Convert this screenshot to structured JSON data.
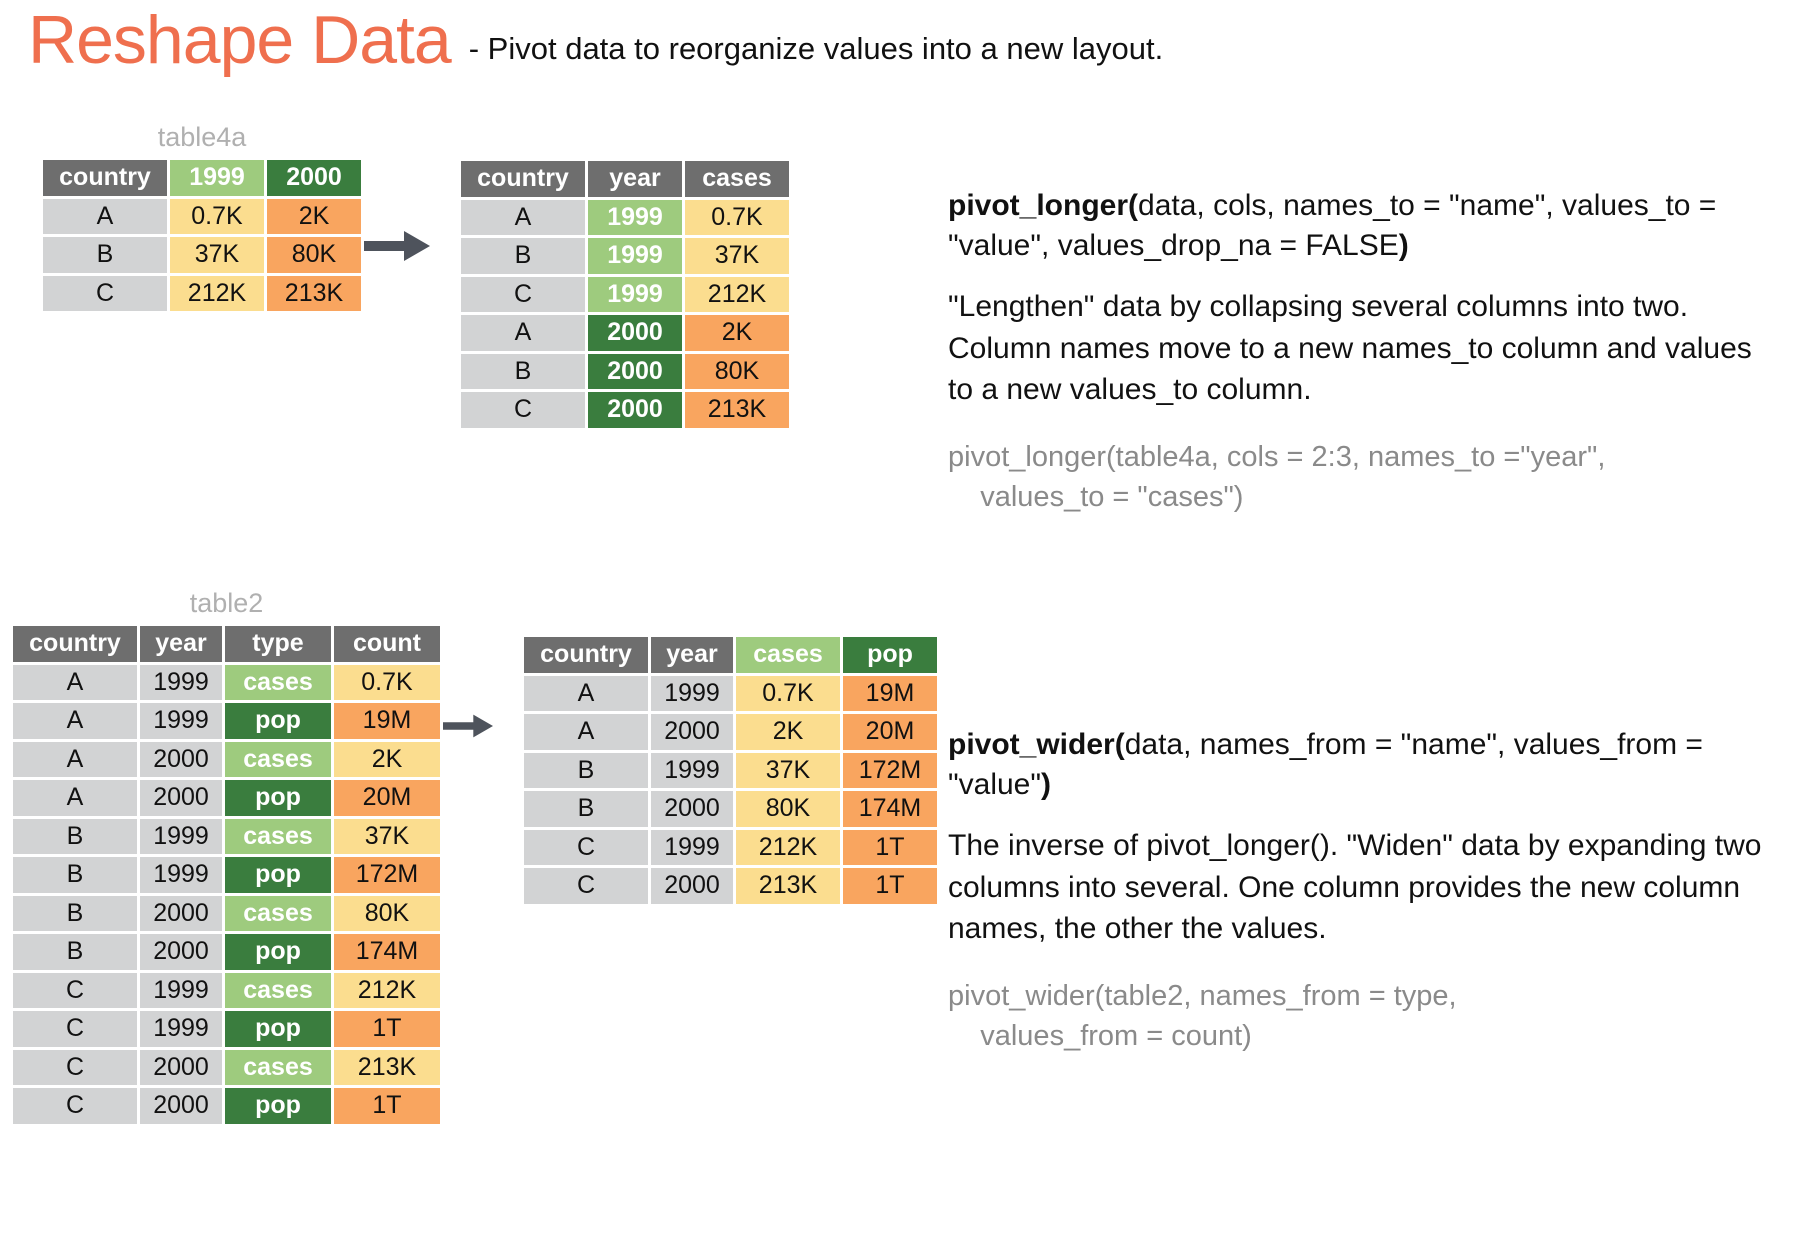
{
  "header": {
    "title": "Reshape Data",
    "subtitle": "- Pivot data to reorganize values into a new layout.",
    "title_color": "#ef6f4e"
  },
  "palette": {
    "header_grey": "#6e6e6e",
    "cell_grey": "#d2d3d4",
    "green_light": "#9ecb7e",
    "green_dark": "#3a7d3e",
    "yellow": "#fbdd8f",
    "orange": "#f9a55f",
    "label_grey": "#b0b0b0",
    "code_grey": "#8a8a8a",
    "arrow": "#4e535c"
  },
  "icons": {
    "arrow_right": "arrow-right-icon"
  },
  "pivot_longer": {
    "source_table": {
      "label": "table4a",
      "headers": [
        "country",
        "1999",
        "2000"
      ],
      "rows": [
        [
          "A",
          "0.7K",
          "2K"
        ],
        [
          "B",
          "37K",
          "80K"
        ],
        [
          "C",
          "212K",
          "213K"
        ]
      ]
    },
    "result_table": {
      "label": "",
      "headers": [
        "country",
        "year",
        "cases"
      ],
      "rows": [
        [
          "A",
          "1999",
          "0.7K"
        ],
        [
          "B",
          "1999",
          "37K"
        ],
        [
          "C",
          "1999",
          "212K"
        ],
        [
          "A",
          "2000",
          "2K"
        ],
        [
          "B",
          "2000",
          "80K"
        ],
        [
          "C",
          "2000",
          "213K"
        ]
      ]
    },
    "signature_bold_open": "pivot_longer(",
    "signature_rest": "data, cols, names_to = \"name\", values_to = \"value\", values_drop_na = FALSE",
    "signature_bold_close": ")",
    "description": "\"Lengthen\" data by collapsing several columns into two. Column names move to a new names_to column and values to a new values_to column.",
    "code": "pivot_longer(table4a, cols = 2:3, names_to =\"year\",\n    values_to = \"cases\")"
  },
  "pivot_wider": {
    "source_table": {
      "label": "table2",
      "headers": [
        "country",
        "year",
        "type",
        "count"
      ],
      "rows": [
        [
          "A",
          "1999",
          "cases",
          "0.7K"
        ],
        [
          "A",
          "1999",
          "pop",
          "19M"
        ],
        [
          "A",
          "2000",
          "cases",
          "2K"
        ],
        [
          "A",
          "2000",
          "pop",
          "20M"
        ],
        [
          "B",
          "1999",
          "cases",
          "37K"
        ],
        [
          "B",
          "1999",
          "pop",
          "172M"
        ],
        [
          "B",
          "2000",
          "cases",
          "80K"
        ],
        [
          "B",
          "2000",
          "pop",
          "174M"
        ],
        [
          "C",
          "1999",
          "cases",
          "212K"
        ],
        [
          "C",
          "1999",
          "pop",
          "1T"
        ],
        [
          "C",
          "2000",
          "cases",
          "213K"
        ],
        [
          "C",
          "2000",
          "pop",
          "1T"
        ]
      ]
    },
    "result_table": {
      "label": "",
      "headers": [
        "country",
        "year",
        "cases",
        "pop"
      ],
      "rows": [
        [
          "A",
          "1999",
          "0.7K",
          "19M"
        ],
        [
          "A",
          "2000",
          "2K",
          "20M"
        ],
        [
          "B",
          "1999",
          "37K",
          "172M"
        ],
        [
          "B",
          "2000",
          "80K",
          "174M"
        ],
        [
          "C",
          "1999",
          "212K",
          "1T"
        ],
        [
          "C",
          "2000",
          "213K",
          "1T"
        ]
      ]
    },
    "signature_bold_open": "pivot_wider(",
    "signature_rest": "data, names_from = \"name\", values_from = \"value\"",
    "signature_bold_close": ")",
    "description": "The inverse of pivot_longer(). \"Widen\" data by expanding two columns into several. One column provides the new column names, the other the values.",
    "code": "pivot_wider(table2, names_from = type,\n    values_from = count)"
  }
}
